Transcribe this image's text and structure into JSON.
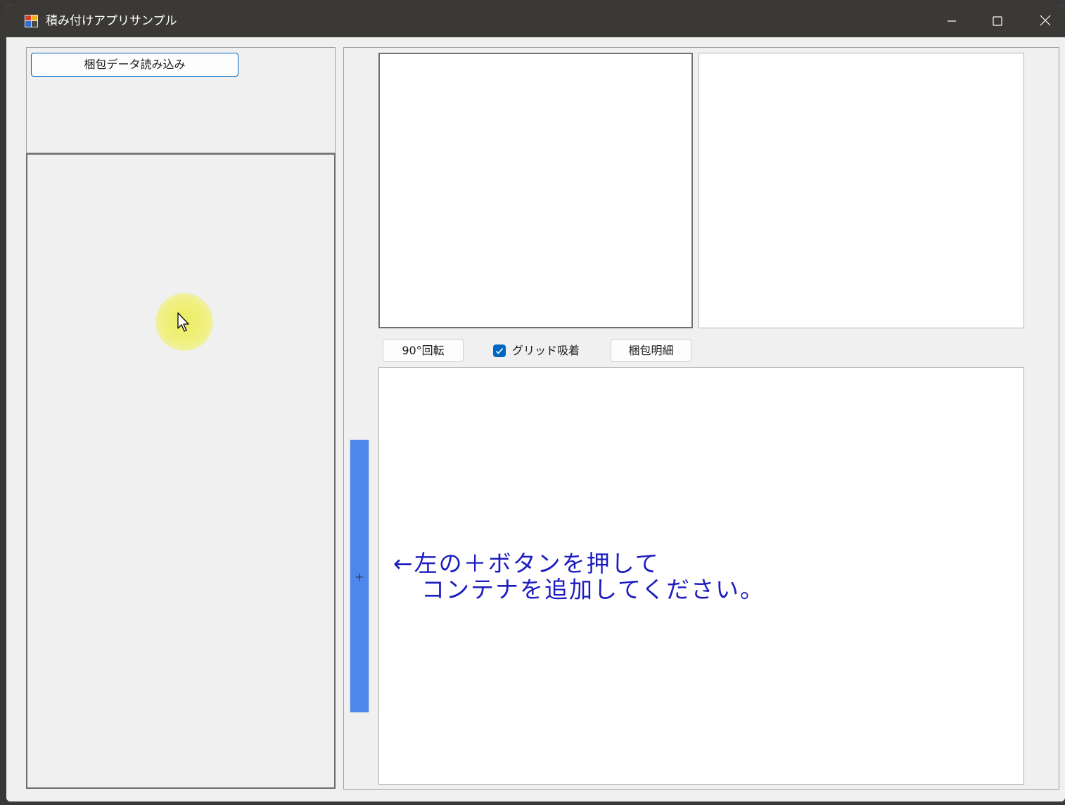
{
  "window": {
    "title": "積み付けアプリサンプル",
    "icons": {
      "app": "app-window-icon",
      "minimize": "minimize-icon",
      "maximize": "maximize-icon",
      "close": "close-icon"
    }
  },
  "left_panel": {
    "load_button_label": "梱包データ読み込み"
  },
  "toolbar": {
    "rotate_label": "90°回転",
    "grid_snap_label": "グリッド吸着",
    "grid_snap_checked": true,
    "detail_label": "梱包明細"
  },
  "add_container": {
    "label": "+"
  },
  "canvas": {
    "hint_line1": "←左の＋ボタンを押して",
    "hint_line2": "コンテナを追加してください。",
    "hint_color": "#1c1cc0"
  },
  "colors": {
    "accent": "#0067c0",
    "add_button": "#4f86eb",
    "cursor_highlight": "#ecec5a"
  }
}
